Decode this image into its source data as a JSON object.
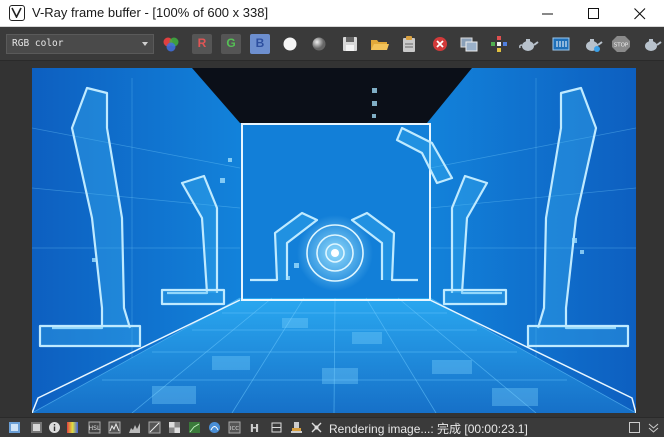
{
  "window": {
    "title": "V-Ray frame buffer - [100% of 600 x 338]",
    "controls": [
      "minimize",
      "maximize",
      "close"
    ]
  },
  "toolbar": {
    "channel": "RGB color",
    "buttons": [
      {
        "name": "channels-icon"
      },
      {
        "name": "red-channel-button",
        "label": "R",
        "color": "#d05050"
      },
      {
        "name": "green-channel-button",
        "label": "G",
        "color": "#50b050"
      },
      {
        "name": "blue-channel-button",
        "label": "B",
        "color": "#5c8fe0"
      },
      {
        "name": "alpha-white-icon"
      },
      {
        "name": "mono-icon"
      },
      {
        "name": "save-icon"
      },
      {
        "name": "open-folder-icon"
      },
      {
        "name": "clipboard-icon"
      },
      {
        "name": "clear-icon"
      },
      {
        "name": "duplicate-icon"
      },
      {
        "name": "region-render-icon"
      },
      {
        "name": "teapot-render-icon"
      },
      {
        "name": "film-strip-icon"
      },
      {
        "name": "teapot-interactive-icon"
      },
      {
        "name": "stop-render-icon"
      },
      {
        "name": "teapot-last-icon"
      }
    ]
  },
  "render": {
    "accent": "#1a7fd6",
    "glow": "#7fd8ff"
  },
  "statusbar": {
    "icons": [
      "vfb-history-icon",
      "color-correction-icon",
      "info-icon",
      "lens-effects-icon",
      "hsl-icon",
      "levels-icon",
      "curve-icon",
      "exposure-icon",
      "bg-image-icon",
      "lut-icon",
      "ocio-icon",
      "icc-icon",
      "h-icon",
      "pixel-aspect-icon",
      "stamp-icon",
      "region-toggle-icon"
    ],
    "text": "Rendering image...: 完成 [00:00:23.1]"
  }
}
